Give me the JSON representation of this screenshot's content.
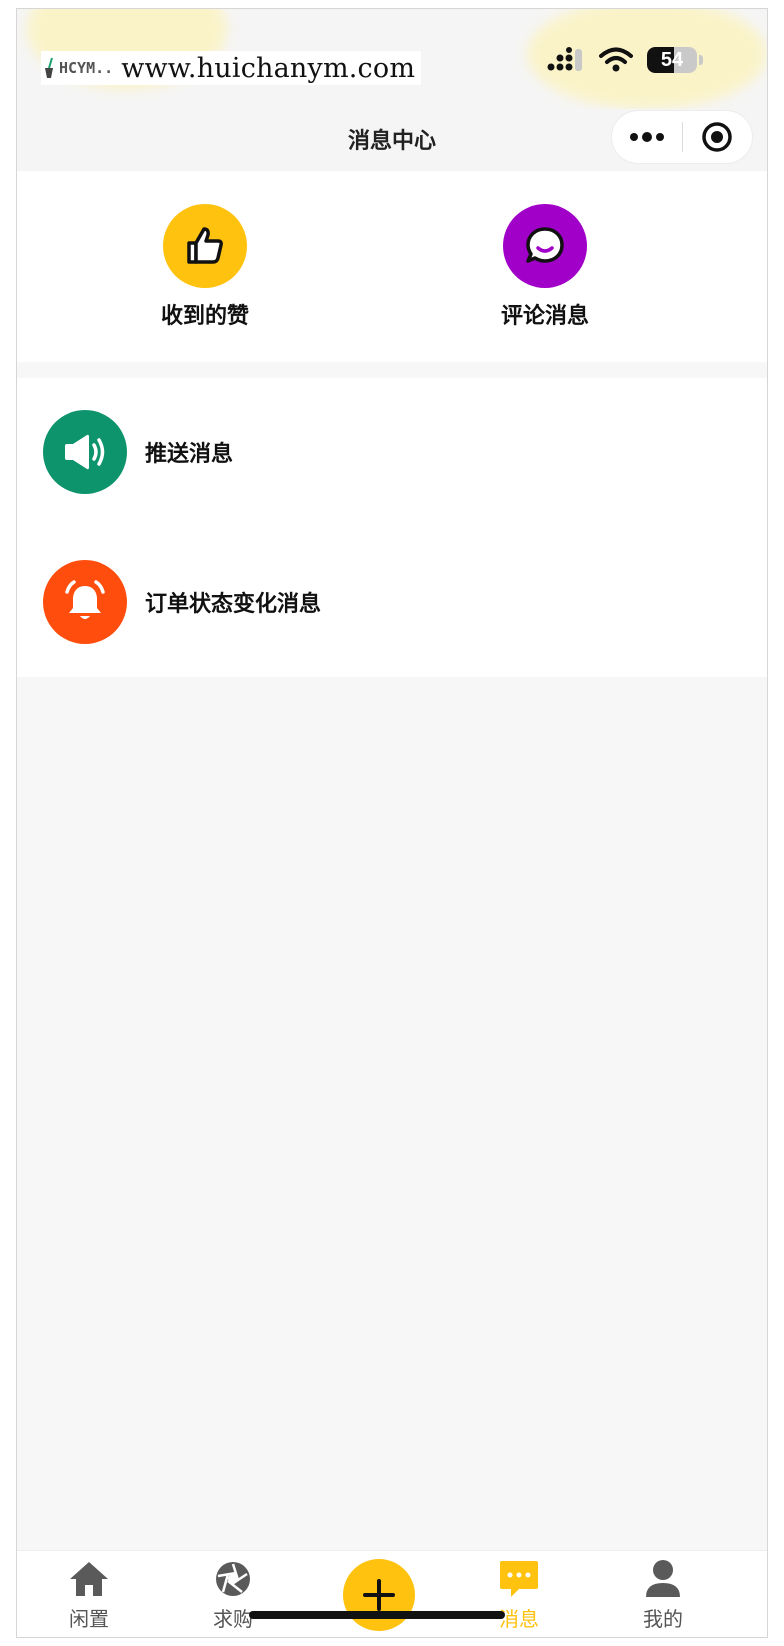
{
  "status_bar": {
    "watermark_logo": "HCYM..",
    "watermark_url": "www.huichanym.com",
    "battery_level": "54",
    "battery_fraction": 0.54
  },
  "nav": {
    "title": "消息中心"
  },
  "quick_actions": [
    {
      "label": "收到的赞",
      "icon": "thumbs-up-icon",
      "color": "#ffc20e"
    },
    {
      "label": "评论消息",
      "icon": "comment-bubble-icon",
      "color": "#a000c8"
    }
  ],
  "message_list": [
    {
      "label": "推送消息",
      "icon": "speaker-icon",
      "color": "#0e946c"
    },
    {
      "label": "订单状态变化消息",
      "icon": "bell-icon",
      "color": "#ff4d0d"
    }
  ],
  "tabbar": {
    "accent": "#ffc20e",
    "items": [
      {
        "label": "闲置",
        "icon": "home-icon",
        "active": false
      },
      {
        "label": "求购",
        "icon": "aperture-icon",
        "active": false
      },
      {
        "label": "消息",
        "icon": "chat-icon",
        "active": true
      },
      {
        "label": "我的",
        "icon": "user-icon",
        "active": false
      }
    ],
    "publish_icon": "plus-icon"
  }
}
